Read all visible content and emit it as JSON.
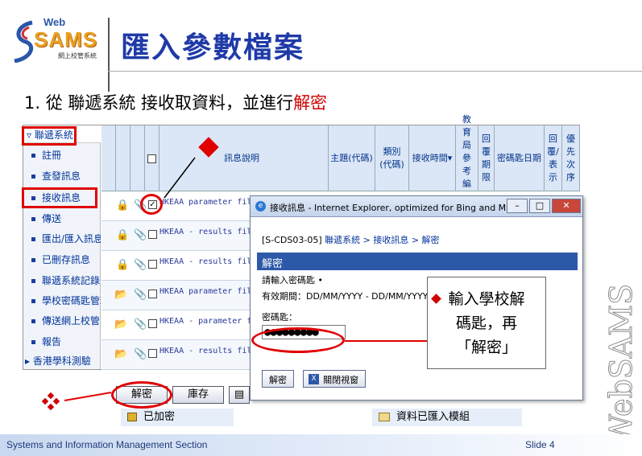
{
  "logo": {
    "web": "Web",
    "sams": "SAMS",
    "sub": "網上校管系統"
  },
  "title": "匯入參數檔案",
  "step": {
    "prefix": "1.  從 聯遞系統 接收取資料，並進行",
    "highlight": "解密"
  },
  "sidebar": {
    "header": "聯遞系統",
    "items": [
      {
        "label": "註冊"
      },
      {
        "label": "查發訊息"
      },
      {
        "label": "接收訊息"
      },
      {
        "label": "傳送"
      },
      {
        "label": "匯出/匯入訊息"
      },
      {
        "label": "已刪存訊息"
      },
      {
        "label": "聯遞系統記錄"
      },
      {
        "label": "學校密碼匙管理"
      },
      {
        "label": "傳送網上校管系統"
      },
      {
        "label": "報告"
      }
    ],
    "footer": "香港學科測驗"
  },
  "grid": {
    "columns": [
      "訊息說明",
      "主題(代碼)",
      "類別(代碼)",
      "接收時間",
      "教育局參考編號",
      "回覆期限",
      "密碼匙日期",
      "回覆/表示",
      "優先次序"
    ],
    "rows": [
      {
        "text": "HKEAA parameter file",
        "checked": true,
        "icon": "lock"
      },
      {
        "text": "HKEAA - results files f",
        "checked": false,
        "icon": "lock"
      },
      {
        "text": "HKEAA - results files f",
        "checked": false,
        "icon": "lock"
      },
      {
        "text": "HKEAA parameter file",
        "checked": false,
        "icon": "folder"
      },
      {
        "text": "HKEAA - parameter file",
        "checked": false,
        "icon": "folder"
      },
      {
        "text": "HKEAA - results files f",
        "checked": false,
        "icon": "folder"
      }
    ]
  },
  "popup": {
    "title": "接收訊息 - Internet Explorer, optimized for Bing and MSN",
    "breadcrumb": {
      "code": "[S-CDS03-05]",
      "path": "聯遞系統 > 接收訊息 > 解密"
    },
    "section": "解密",
    "prompt": "請輸入密碼匙 •",
    "validity": "有效期間：DD/MM/YYYY - DD/MM/YYYY",
    "key_label": "密碼匙：",
    "key_value": "●●●●●●●●●",
    "decrypt_btn": "解密",
    "close_btn": "關閉視窗"
  },
  "callout": {
    "line1": "輸入學校解",
    "line2": "碼匙，再",
    "line3": "「解密」"
  },
  "bottom": {
    "decrypt": "解密",
    "library": "庫存"
  },
  "legend": {
    "encrypted": "已加密",
    "imported": "資料已匯入模組"
  },
  "footer": {
    "left": "Systems and Information Management Section",
    "right": "Slide 4"
  },
  "watermark": "WebSAMS",
  "colors": {
    "title": "#1f3aa8",
    "accent_red": "#e00000",
    "header_blue": "#2c58a8"
  }
}
